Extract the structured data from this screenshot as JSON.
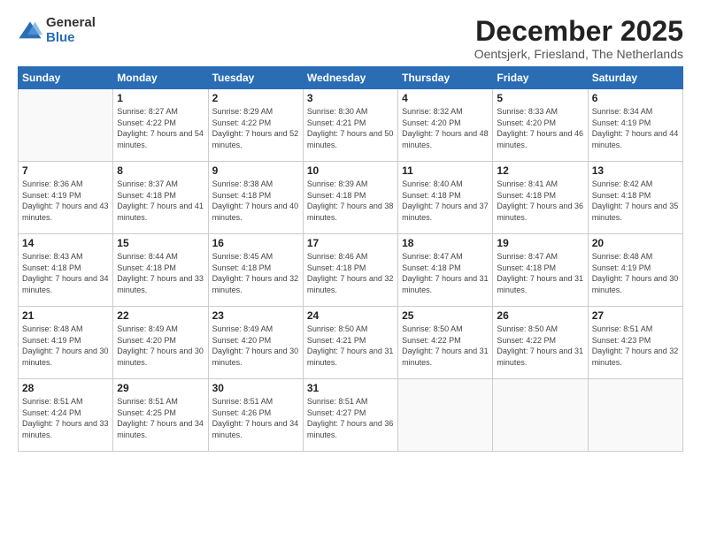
{
  "logo": {
    "general": "General",
    "blue": "Blue"
  },
  "title": {
    "month": "December 2025",
    "location": "Oentsjerk, Friesland, The Netherlands"
  },
  "header": {
    "days": [
      "Sunday",
      "Monday",
      "Tuesday",
      "Wednesday",
      "Thursday",
      "Friday",
      "Saturday"
    ]
  },
  "weeks": [
    [
      {
        "day": "",
        "sunrise": "",
        "sunset": "",
        "daylight": ""
      },
      {
        "day": "1",
        "sunrise": "Sunrise: 8:27 AM",
        "sunset": "Sunset: 4:22 PM",
        "daylight": "Daylight: 7 hours and 54 minutes."
      },
      {
        "day": "2",
        "sunrise": "Sunrise: 8:29 AM",
        "sunset": "Sunset: 4:22 PM",
        "daylight": "Daylight: 7 hours and 52 minutes."
      },
      {
        "day": "3",
        "sunrise": "Sunrise: 8:30 AM",
        "sunset": "Sunset: 4:21 PM",
        "daylight": "Daylight: 7 hours and 50 minutes."
      },
      {
        "day": "4",
        "sunrise": "Sunrise: 8:32 AM",
        "sunset": "Sunset: 4:20 PM",
        "daylight": "Daylight: 7 hours and 48 minutes."
      },
      {
        "day": "5",
        "sunrise": "Sunrise: 8:33 AM",
        "sunset": "Sunset: 4:20 PM",
        "daylight": "Daylight: 7 hours and 46 minutes."
      },
      {
        "day": "6",
        "sunrise": "Sunrise: 8:34 AM",
        "sunset": "Sunset: 4:19 PM",
        "daylight": "Daylight: 7 hours and 44 minutes."
      }
    ],
    [
      {
        "day": "7",
        "sunrise": "Sunrise: 8:36 AM",
        "sunset": "Sunset: 4:19 PM",
        "daylight": "Daylight: 7 hours and 43 minutes."
      },
      {
        "day": "8",
        "sunrise": "Sunrise: 8:37 AM",
        "sunset": "Sunset: 4:18 PM",
        "daylight": "Daylight: 7 hours and 41 minutes."
      },
      {
        "day": "9",
        "sunrise": "Sunrise: 8:38 AM",
        "sunset": "Sunset: 4:18 PM",
        "daylight": "Daylight: 7 hours and 40 minutes."
      },
      {
        "day": "10",
        "sunrise": "Sunrise: 8:39 AM",
        "sunset": "Sunset: 4:18 PM",
        "daylight": "Daylight: 7 hours and 38 minutes."
      },
      {
        "day": "11",
        "sunrise": "Sunrise: 8:40 AM",
        "sunset": "Sunset: 4:18 PM",
        "daylight": "Daylight: 7 hours and 37 minutes."
      },
      {
        "day": "12",
        "sunrise": "Sunrise: 8:41 AM",
        "sunset": "Sunset: 4:18 PM",
        "daylight": "Daylight: 7 hours and 36 minutes."
      },
      {
        "day": "13",
        "sunrise": "Sunrise: 8:42 AM",
        "sunset": "Sunset: 4:18 PM",
        "daylight": "Daylight: 7 hours and 35 minutes."
      }
    ],
    [
      {
        "day": "14",
        "sunrise": "Sunrise: 8:43 AM",
        "sunset": "Sunset: 4:18 PM",
        "daylight": "Daylight: 7 hours and 34 minutes."
      },
      {
        "day": "15",
        "sunrise": "Sunrise: 8:44 AM",
        "sunset": "Sunset: 4:18 PM",
        "daylight": "Daylight: 7 hours and 33 minutes."
      },
      {
        "day": "16",
        "sunrise": "Sunrise: 8:45 AM",
        "sunset": "Sunset: 4:18 PM",
        "daylight": "Daylight: 7 hours and 32 minutes."
      },
      {
        "day": "17",
        "sunrise": "Sunrise: 8:46 AM",
        "sunset": "Sunset: 4:18 PM",
        "daylight": "Daylight: 7 hours and 32 minutes."
      },
      {
        "day": "18",
        "sunrise": "Sunrise: 8:47 AM",
        "sunset": "Sunset: 4:18 PM",
        "daylight": "Daylight: 7 hours and 31 minutes."
      },
      {
        "day": "19",
        "sunrise": "Sunrise: 8:47 AM",
        "sunset": "Sunset: 4:18 PM",
        "daylight": "Daylight: 7 hours and 31 minutes."
      },
      {
        "day": "20",
        "sunrise": "Sunrise: 8:48 AM",
        "sunset": "Sunset: 4:19 PM",
        "daylight": "Daylight: 7 hours and 30 minutes."
      }
    ],
    [
      {
        "day": "21",
        "sunrise": "Sunrise: 8:48 AM",
        "sunset": "Sunset: 4:19 PM",
        "daylight": "Daylight: 7 hours and 30 minutes."
      },
      {
        "day": "22",
        "sunrise": "Sunrise: 8:49 AM",
        "sunset": "Sunset: 4:20 PM",
        "daylight": "Daylight: 7 hours and 30 minutes."
      },
      {
        "day": "23",
        "sunrise": "Sunrise: 8:49 AM",
        "sunset": "Sunset: 4:20 PM",
        "daylight": "Daylight: 7 hours and 30 minutes."
      },
      {
        "day": "24",
        "sunrise": "Sunrise: 8:50 AM",
        "sunset": "Sunset: 4:21 PM",
        "daylight": "Daylight: 7 hours and 31 minutes."
      },
      {
        "day": "25",
        "sunrise": "Sunrise: 8:50 AM",
        "sunset": "Sunset: 4:22 PM",
        "daylight": "Daylight: 7 hours and 31 minutes."
      },
      {
        "day": "26",
        "sunrise": "Sunrise: 8:50 AM",
        "sunset": "Sunset: 4:22 PM",
        "daylight": "Daylight: 7 hours and 31 minutes."
      },
      {
        "day": "27",
        "sunrise": "Sunrise: 8:51 AM",
        "sunset": "Sunset: 4:23 PM",
        "daylight": "Daylight: 7 hours and 32 minutes."
      }
    ],
    [
      {
        "day": "28",
        "sunrise": "Sunrise: 8:51 AM",
        "sunset": "Sunset: 4:24 PM",
        "daylight": "Daylight: 7 hours and 33 minutes."
      },
      {
        "day": "29",
        "sunrise": "Sunrise: 8:51 AM",
        "sunset": "Sunset: 4:25 PM",
        "daylight": "Daylight: 7 hours and 34 minutes."
      },
      {
        "day": "30",
        "sunrise": "Sunrise: 8:51 AM",
        "sunset": "Sunset: 4:26 PM",
        "daylight": "Daylight: 7 hours and 34 minutes."
      },
      {
        "day": "31",
        "sunrise": "Sunrise: 8:51 AM",
        "sunset": "Sunset: 4:27 PM",
        "daylight": "Daylight: 7 hours and 36 minutes."
      },
      {
        "day": "",
        "sunrise": "",
        "sunset": "",
        "daylight": ""
      },
      {
        "day": "",
        "sunrise": "",
        "sunset": "",
        "daylight": ""
      },
      {
        "day": "",
        "sunrise": "",
        "sunset": "",
        "daylight": ""
      }
    ]
  ]
}
